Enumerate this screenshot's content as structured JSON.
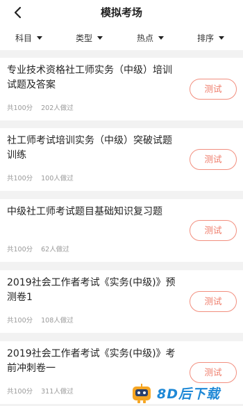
{
  "header": {
    "title": "模拟考场",
    "back_icon": "chevron-left-icon"
  },
  "filters": [
    {
      "label": "科目",
      "icon": "caret-down-icon"
    },
    {
      "label": "类型",
      "icon": "caret-down-icon"
    },
    {
      "label": "热点",
      "icon": "caret-down-icon"
    },
    {
      "label": "排序",
      "icon": "caret-down-icon"
    }
  ],
  "exams": [
    {
      "title": "专业技术资格社工师实务（中级）培训试题及答案",
      "total": "共100分",
      "takers": "202人做过",
      "button": "测试"
    },
    {
      "title": "社工师考试培训实务（中级）突破试题训练",
      "total": "共100分",
      "takers": "100人做过",
      "button": "测试"
    },
    {
      "title": "中级社工师考试题目基础知识复习题",
      "total": "共100分",
      "takers": "62人做过",
      "button": "测试"
    },
    {
      "title": "2019社会工作者考试《实务(中级)》预测卷1",
      "total": "共100分",
      "takers": "108人做过",
      "button": "测试"
    },
    {
      "title": "2019社会工作者考试《实务(中级)》考前冲刺卷一",
      "total": "共100分",
      "takers": "311人做过",
      "button": "测试"
    }
  ],
  "watermark": {
    "text": "8D后下载",
    "icon": "robot-logo-icon"
  },
  "colors": {
    "accent": "#ef7c6a",
    "background": "#f2f2f2",
    "watermark": "#1e88d6"
  }
}
